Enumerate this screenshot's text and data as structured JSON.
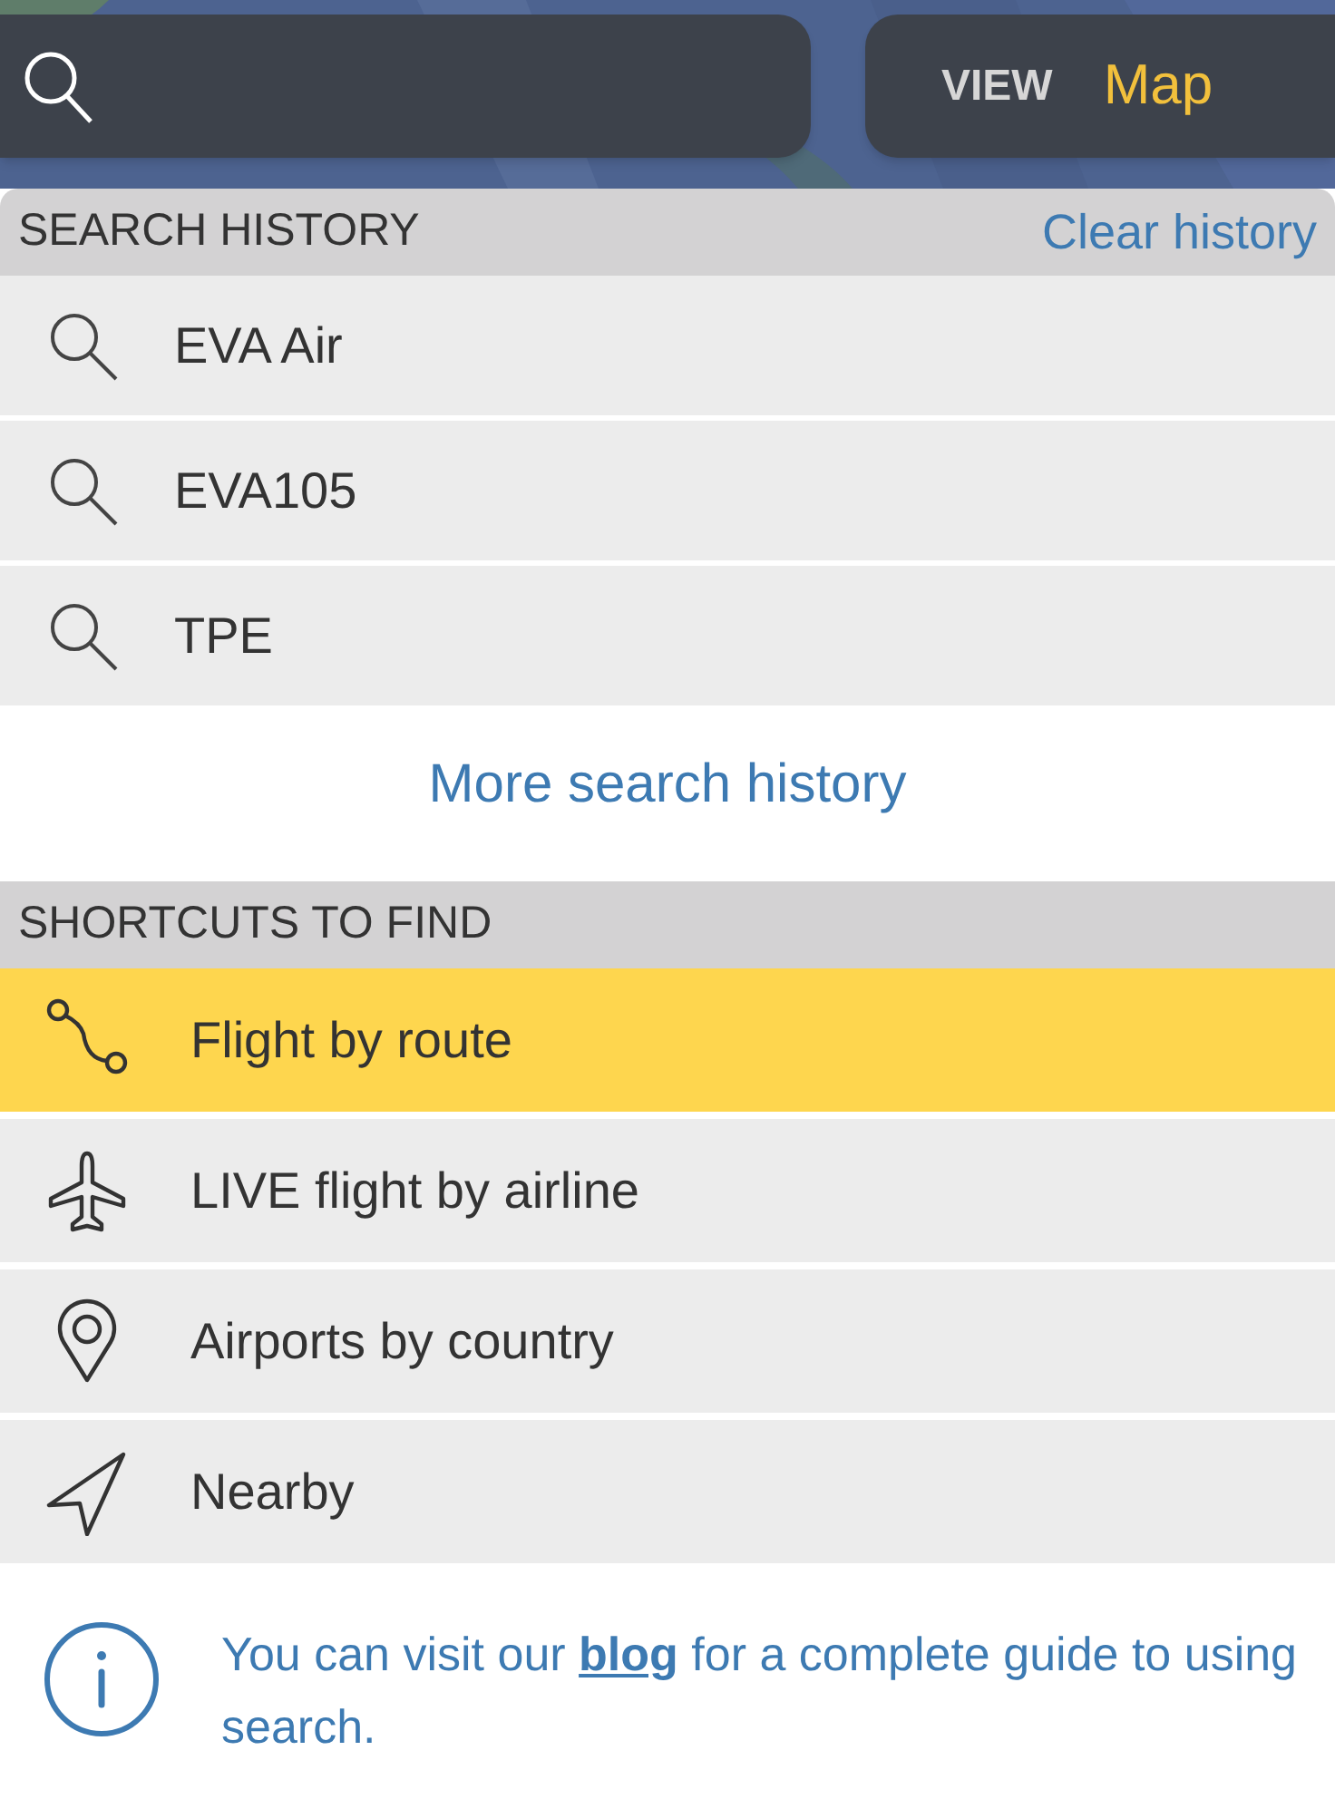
{
  "top_bar": {
    "view_button": {
      "label": "VIEW",
      "value": "Map"
    }
  },
  "search_history": {
    "title": "SEARCH HISTORY",
    "clear_link": "Clear history",
    "items": [
      {
        "label": "EVA Air"
      },
      {
        "label": "EVA105"
      },
      {
        "label": "TPE"
      }
    ],
    "more_link": "More search history"
  },
  "shortcuts": {
    "title": "SHORTCUTS TO FIND",
    "items": [
      {
        "kind": "route",
        "label": "Flight by route",
        "selected": true
      },
      {
        "kind": "plane",
        "label": "LIVE flight by airline",
        "selected": false
      },
      {
        "kind": "pin",
        "label": "Airports by country",
        "selected": false
      },
      {
        "kind": "arrow",
        "label": "Nearby",
        "selected": false
      }
    ]
  },
  "info": {
    "before": "You can visit our ",
    "link": "blog",
    "after": " for a complete guide to using search."
  }
}
